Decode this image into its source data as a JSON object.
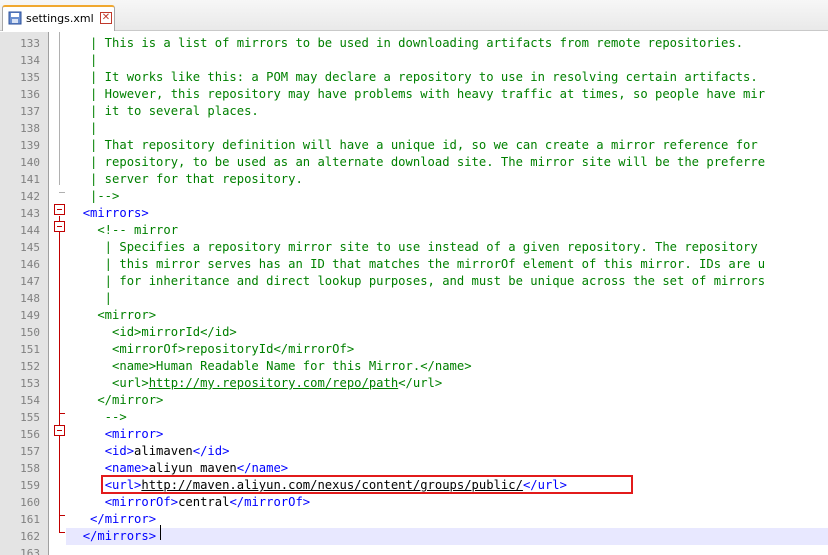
{
  "tab": {
    "file_name": "settings.xml",
    "file_icon": "file-save-icon",
    "close_icon": "close-icon",
    "close_glyph": "✕"
  },
  "colors": {
    "tag": "#0000ff",
    "comment": "#008000",
    "text": "#000000",
    "line_number": "#808080",
    "fold_marker": "#c00000",
    "highlight_box": "#e21b1b",
    "current_line": "#e8e8ff"
  },
  "lines": [
    {
      "n": "133",
      "parts": [
        {
          "t": "c",
          "v": "   | This is a list of mirrors to be used in downloading artifacts from remote repositories."
        }
      ]
    },
    {
      "n": "134",
      "parts": [
        {
          "t": "c",
          "v": "   |"
        }
      ]
    },
    {
      "n": "135",
      "parts": [
        {
          "t": "c",
          "v": "   | It works like this: a POM may declare a repository to use in resolving certain artifacts."
        }
      ]
    },
    {
      "n": "136",
      "parts": [
        {
          "t": "c",
          "v": "   | However, this repository may have problems with heavy traffic at times, so people have mir"
        }
      ]
    },
    {
      "n": "137",
      "parts": [
        {
          "t": "c",
          "v": "   | it to several places."
        }
      ]
    },
    {
      "n": "138",
      "parts": [
        {
          "t": "c",
          "v": "   |"
        }
      ]
    },
    {
      "n": "139",
      "parts": [
        {
          "t": "c",
          "v": "   | That repository definition will have a unique id, so we can create a mirror reference for"
        }
      ]
    },
    {
      "n": "140",
      "parts": [
        {
          "t": "c",
          "v": "   | repository, to be used as an alternate download site. The mirror site will be the preferre"
        }
      ]
    },
    {
      "n": "141",
      "parts": [
        {
          "t": "c",
          "v": "   | server for that repository."
        }
      ]
    },
    {
      "n": "142",
      "parts": [
        {
          "t": "c",
          "v": "   |-->"
        }
      ]
    },
    {
      "n": "143",
      "parts": [
        {
          "t": "g",
          "v": "  "
        },
        {
          "t": "tag",
          "v": "<mirrors>"
        }
      ]
    },
    {
      "n": "144",
      "parts": [
        {
          "t": "c",
          "v": "    <!-- mirror"
        }
      ]
    },
    {
      "n": "145",
      "parts": [
        {
          "t": "c",
          "v": "     | Specifies a repository mirror site to use instead of a given repository. The repository"
        }
      ]
    },
    {
      "n": "146",
      "parts": [
        {
          "t": "c",
          "v": "     | this mirror serves has an ID that matches the mirrorOf element of this mirror. IDs are u"
        }
      ]
    },
    {
      "n": "147",
      "parts": [
        {
          "t": "c",
          "v": "     | for inheritance and direct lookup purposes, and must be unique across the set of mirrors"
        }
      ]
    },
    {
      "n": "148",
      "parts": [
        {
          "t": "c",
          "v": "     |"
        }
      ]
    },
    {
      "n": "149",
      "parts": [
        {
          "t": "c",
          "v": "    <mirror>"
        }
      ]
    },
    {
      "n": "150",
      "parts": [
        {
          "t": "c",
          "v": "      <id>mirrorId</id>"
        }
      ]
    },
    {
      "n": "151",
      "parts": [
        {
          "t": "c",
          "v": "      <mirrorOf>repositoryId</mirrorOf>"
        }
      ]
    },
    {
      "n": "152",
      "parts": [
        {
          "t": "c",
          "v": "      <name>Human Readable Name for this Mirror.</name>"
        }
      ]
    },
    {
      "n": "153",
      "parts": [
        {
          "t": "c",
          "v": "      <url>"
        },
        {
          "t": "curl",
          "v": "http://my.repository.com/repo/path"
        },
        {
          "t": "c",
          "v": "</url>"
        }
      ]
    },
    {
      "n": "154",
      "parts": [
        {
          "t": "c",
          "v": "    </mirror>"
        }
      ]
    },
    {
      "n": "155",
      "parts": [
        {
          "t": "c",
          "v": "     -->"
        }
      ]
    },
    {
      "n": "156",
      "parts": [
        {
          "t": "g",
          "v": "     "
        },
        {
          "t": "tag",
          "v": "<mirror>"
        }
      ]
    },
    {
      "n": "157",
      "parts": [
        {
          "t": "g",
          "v": "     "
        },
        {
          "t": "tag",
          "v": "<id>"
        },
        {
          "t": "plain",
          "v": "alimaven"
        },
        {
          "t": "tag",
          "v": "</id>"
        }
      ]
    },
    {
      "n": "158",
      "parts": [
        {
          "t": "g",
          "v": "     "
        },
        {
          "t": "tag",
          "v": "<name>"
        },
        {
          "t": "plain",
          "v": "aliyun maven"
        },
        {
          "t": "tag",
          "v": "</name>"
        }
      ]
    },
    {
      "n": "159",
      "parts": [
        {
          "t": "g",
          "v": "     "
        },
        {
          "t": "tag",
          "v": "<url>"
        },
        {
          "t": "url",
          "v": "http://maven.aliyun.com/nexus/content/groups/public/"
        },
        {
          "t": "tag",
          "v": "</url>"
        }
      ]
    },
    {
      "n": "160",
      "parts": [
        {
          "t": "g",
          "v": "     "
        },
        {
          "t": "tag",
          "v": "<mirrorOf>"
        },
        {
          "t": "plain",
          "v": "central"
        },
        {
          "t": "tag",
          "v": "</mirrorOf>"
        }
      ]
    },
    {
      "n": "161",
      "parts": [
        {
          "t": "g",
          "v": "   "
        },
        {
          "t": "tag",
          "v": "</mirror>"
        }
      ]
    },
    {
      "n": "162",
      "parts": [
        {
          "t": "g",
          "v": "  "
        },
        {
          "t": "tag",
          "v": "</mirrors>"
        }
      ]
    },
    {
      "n": "163",
      "parts": []
    }
  ]
}
